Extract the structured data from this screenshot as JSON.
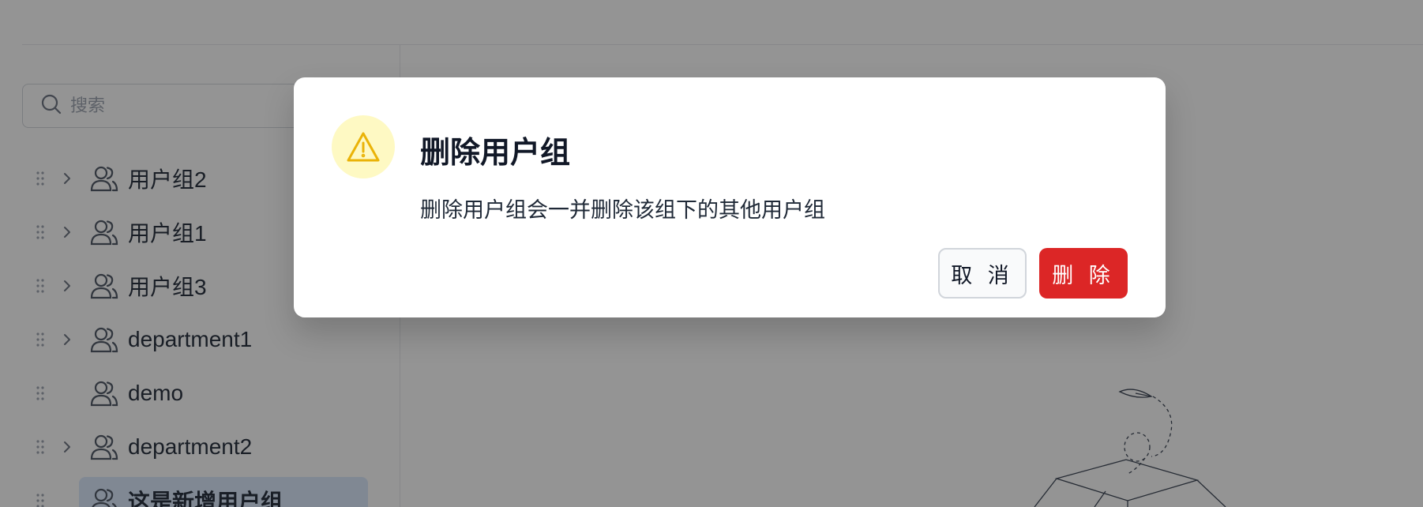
{
  "search": {
    "placeholder": "搜索"
  },
  "tree": {
    "items": [
      {
        "label": "用户组2",
        "has_children": true
      },
      {
        "label": "用户组1",
        "has_children": true
      },
      {
        "label": "用户组3",
        "has_children": true
      },
      {
        "label": "department1",
        "has_children": true
      },
      {
        "label": "demo",
        "has_children": false
      },
      {
        "label": "department2",
        "has_children": true
      },
      {
        "label": "这是新增用户组",
        "has_children": false,
        "selected": true
      }
    ]
  },
  "dialog": {
    "title": "删除用户组",
    "message": "删除用户组会一并删除该组下的其他用户组",
    "cancel_label": "取 消",
    "delete_label": "删 除",
    "icon": "warning-icon"
  },
  "colors": {
    "danger": "#dc2626",
    "warning": "#eab308",
    "warning_bg": "#fef9c3",
    "selected_bg": "#dbeafe"
  }
}
